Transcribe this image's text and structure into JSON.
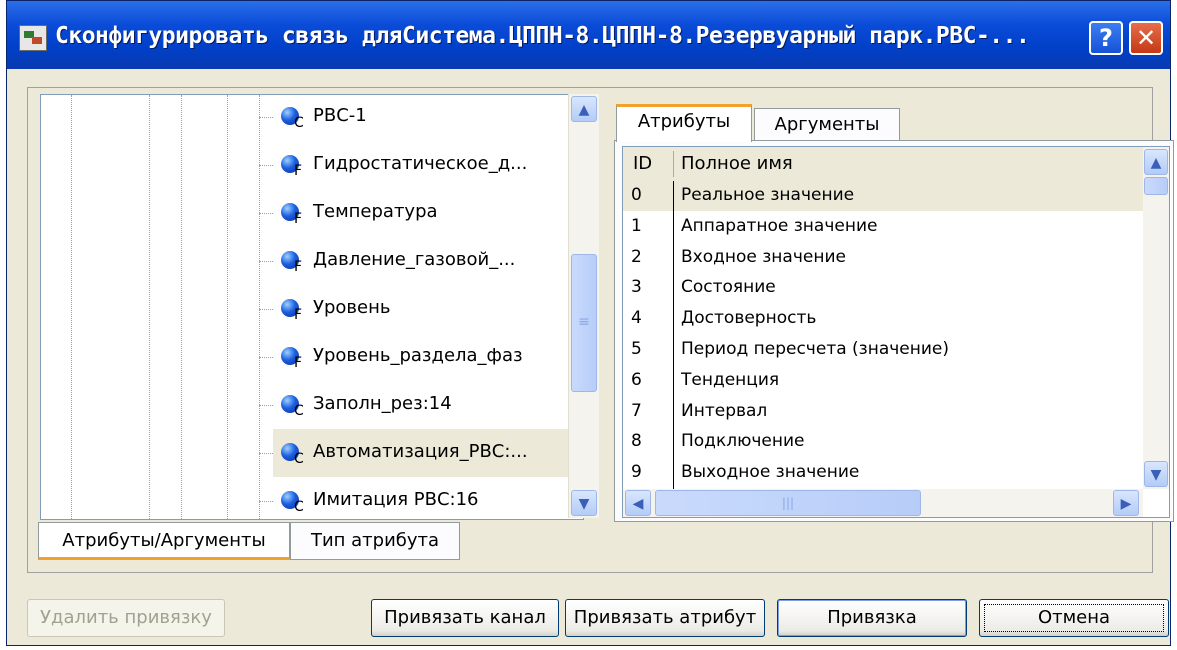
{
  "window": {
    "title": "Сконфигурировать связь дляСистема.ЦППН-8.ЦППН-8.Резервуарный парк.РВС-...",
    "help_label": "?",
    "close_label": "✕"
  },
  "tree": {
    "items": [
      {
        "type": "C",
        "label": "РВС-1"
      },
      {
        "type": "F",
        "label": "Гидростатическое_д..."
      },
      {
        "type": "F",
        "label": "Температура"
      },
      {
        "type": "F",
        "label": "Давление_газовой_..."
      },
      {
        "type": "F",
        "label": "Уровень"
      },
      {
        "type": "F",
        "label": "Уровень_раздела_фаз"
      },
      {
        "type": "C",
        "label": "Заполн_рез:14"
      },
      {
        "type": "C",
        "label": "Автоматизация_РВС:...",
        "selected": true
      },
      {
        "type": "C",
        "label": "Имитация РВС:16"
      }
    ]
  },
  "right_tabs": {
    "attributes": "Атрибуты",
    "arguments": "Аргументы"
  },
  "grid": {
    "headers": {
      "id": "ID",
      "name": "Полное имя"
    },
    "rows": [
      {
        "id": "0",
        "name": "Реальное значение",
        "selected": true
      },
      {
        "id": "1",
        "name": "Аппаратное значение"
      },
      {
        "id": "2",
        "name": "Входное значение"
      },
      {
        "id": "3",
        "name": "Состояние"
      },
      {
        "id": "4",
        "name": "Достоверность"
      },
      {
        "id": "5",
        "name": "Период пересчета (значение)"
      },
      {
        "id": "6",
        "name": "Тенденция"
      },
      {
        "id": "7",
        "name": "Интервал"
      },
      {
        "id": "8",
        "name": "Подключение"
      },
      {
        "id": "9",
        "name": "Выходное значение"
      }
    ]
  },
  "bottom_tabs": {
    "attr_args": "Атрибуты/Аргументы",
    "attr_type": "Тип атрибута"
  },
  "buttons": {
    "remove_binding": "Удалить привязку",
    "bind_channel": "Привязать канал",
    "bind_attribute": "Привязать атрибут",
    "binding": "Привязка",
    "cancel": "Отмена"
  },
  "scroll_glyphs": {
    "up": "▲",
    "down": "▼",
    "left": "◀",
    "right": "▶",
    "grip": "≡",
    "grip_h": "|||"
  }
}
